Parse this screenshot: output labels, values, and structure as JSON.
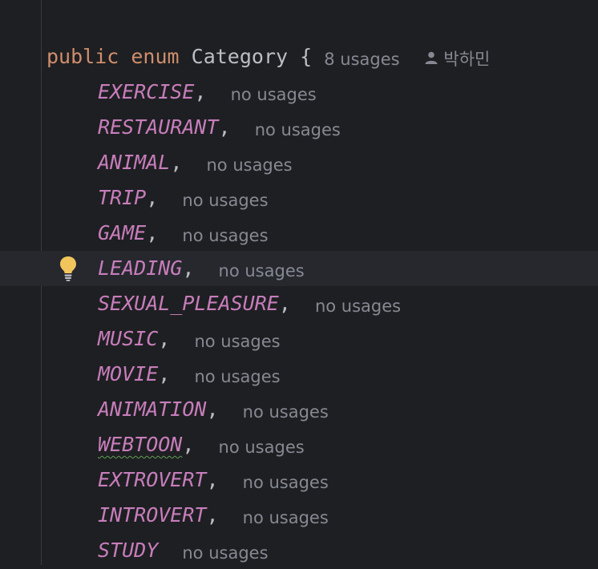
{
  "header": {
    "kw_public": "public",
    "kw_enum": "enum",
    "class_name": "Category",
    "open_brace": "{",
    "usages_hint": "8 usages",
    "author_name": "박하민"
  },
  "entries": [
    {
      "name": "EXERCISE",
      "sep": ",",
      "hint": "no usages"
    },
    {
      "name": "RESTAURANT",
      "sep": ",",
      "hint": "no usages"
    },
    {
      "name": "ANIMAL",
      "sep": ",",
      "hint": "no usages"
    },
    {
      "name": "TRIP",
      "sep": ",",
      "hint": "no usages"
    },
    {
      "name": "GAME",
      "sep": ",",
      "hint": "no usages"
    },
    {
      "name": "LEADING",
      "sep": ",",
      "hint": "no usages"
    },
    {
      "name": "SEXUAL_PLEASURE",
      "sep": ",",
      "hint": "no usages"
    },
    {
      "name": "MUSIC",
      "sep": ",",
      "hint": "no usages"
    },
    {
      "name": "MOVIE",
      "sep": ",",
      "hint": "no usages"
    },
    {
      "name": "ANIMATION",
      "sep": ",",
      "hint": "no usages"
    },
    {
      "name": "WEBTOON",
      "sep": ",",
      "hint": "no usages"
    },
    {
      "name": "EXTROVERT",
      "sep": ",",
      "hint": "no usages"
    },
    {
      "name": "INTROVERT",
      "sep": ",",
      "hint": "no usages"
    },
    {
      "name": "STUDY",
      "sep": "",
      "hint": "no usages"
    }
  ],
  "colors": {
    "background": "#1e1f22",
    "keyword": "#cf8e6d",
    "enum_constant": "#c77dbb",
    "identifier": "#bcbec4",
    "inlay_hint": "#868993",
    "current_line": "#26282e",
    "bulb": "#f2c55c"
  },
  "icons": {
    "author": "person-icon",
    "intention": "lightbulb-icon"
  }
}
